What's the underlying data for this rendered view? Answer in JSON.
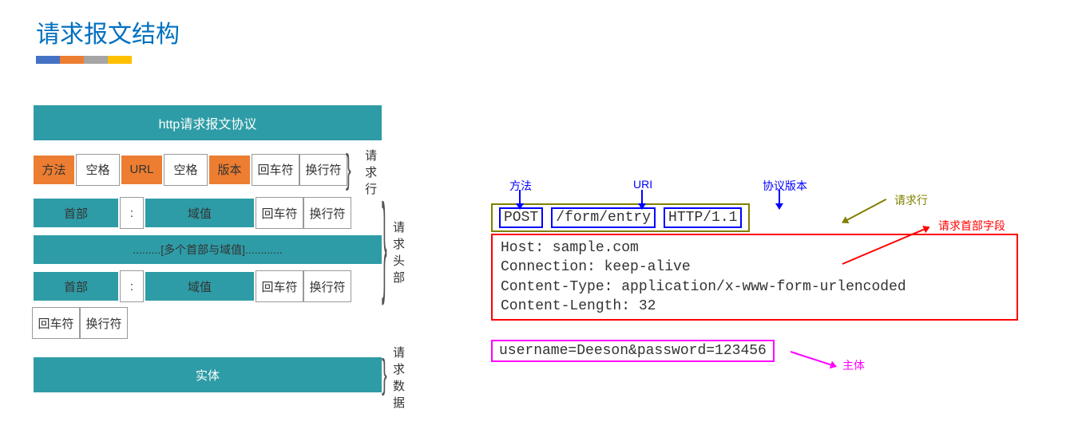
{
  "title": "请求报文结构",
  "left": {
    "header": "http请求报文协议",
    "row1": [
      "方法",
      "空格",
      "URL",
      "空格",
      "版本",
      "回车符",
      "换行符"
    ],
    "label1": "请求行",
    "row2": [
      "首部",
      ":",
      "域值",
      "回车符",
      "换行符"
    ],
    "row3": ".........[多个首部与域值]............",
    "row4": [
      "首部",
      ":",
      "域值",
      "回车符",
      "换行符"
    ],
    "label2": "请求头部",
    "row5": [
      "回车符",
      "换行符"
    ],
    "row6": "实体",
    "label3": "请求数据"
  },
  "right": {
    "method_lbl": "方法",
    "uri_lbl": "URI",
    "ver_lbl": "协议版本",
    "line_lbl": "请求行",
    "method": "POST",
    "uri": "/form/entry",
    "version": "HTTP/1.1",
    "headers_lbl": "请求首部字段",
    "headers": [
      "Host: sample.com",
      "Connection: keep-alive",
      "Content-Type: application/x-www-form-urlencoded",
      "Content-Length: 32"
    ],
    "body": "username=Deeson&password=123456",
    "body_lbl": "主体"
  }
}
